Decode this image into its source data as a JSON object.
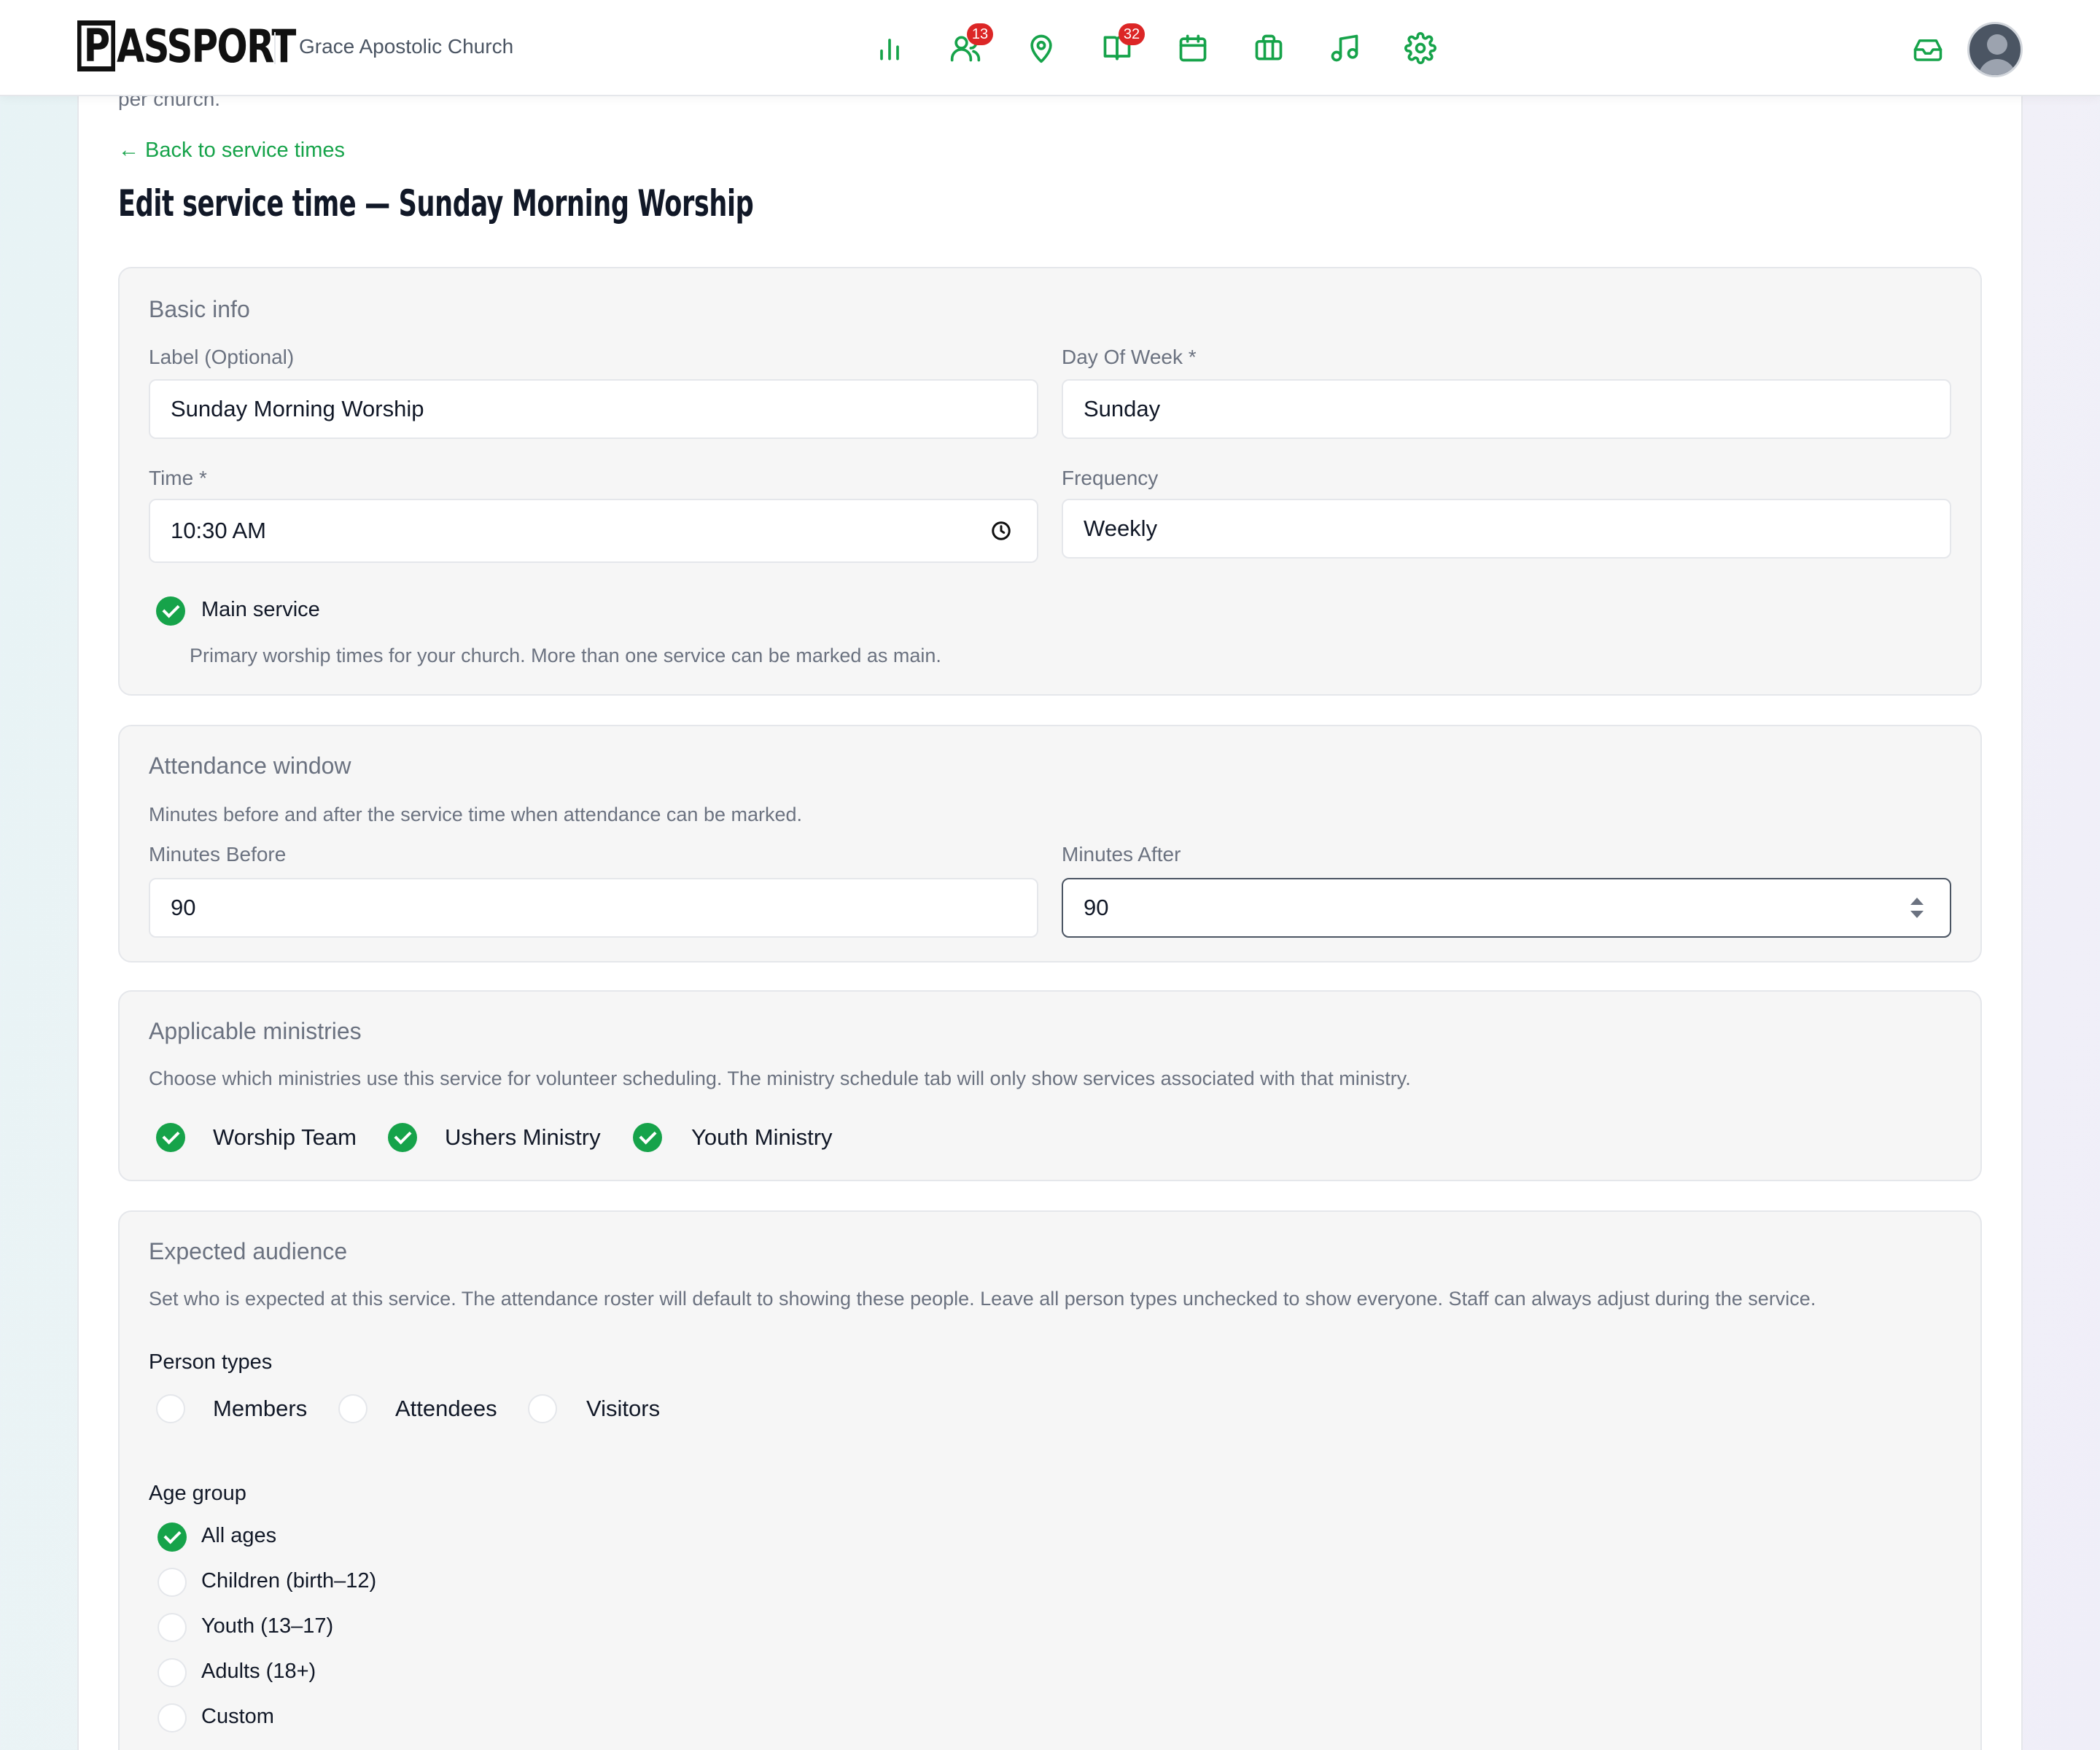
{
  "header": {
    "logo_text_p": "P",
    "logo_text_rest": "ASSPORT",
    "church_name": "Grace Apostolic Church",
    "nav": [
      {
        "icon": "bar-chart-icon",
        "badge": ""
      },
      {
        "icon": "people-icon",
        "badge": "13"
      },
      {
        "icon": "map-pin-icon",
        "badge": ""
      },
      {
        "icon": "book-open-icon",
        "badge": "32"
      },
      {
        "icon": "calendar-icon",
        "badge": ""
      },
      {
        "icon": "briefcase-icon",
        "badge": ""
      },
      {
        "icon": "music-icon",
        "badge": ""
      },
      {
        "icon": "gear-icon",
        "badge": ""
      }
    ],
    "accent_color": "#16a34a",
    "badge_color": "#dc2626"
  },
  "page": {
    "cut_text": "per church.",
    "back_link": "← Back to service times",
    "title": "Edit service time — Sunday Morning Worship"
  },
  "basic_info": {
    "title": "Basic info",
    "label_field": {
      "label": "Label (Optional)",
      "value": "Sunday Morning Worship"
    },
    "day_field": {
      "label": "Day Of Week *",
      "value": "Sunday"
    },
    "time_field": {
      "label": "Time *",
      "value": "10:30 AM"
    },
    "frequency_field": {
      "label": "Frequency",
      "value": "Weekly"
    },
    "main_service": {
      "label": "Main service",
      "checked": true,
      "help": "Primary worship times for your church. More than one service can be marked as main."
    }
  },
  "attendance": {
    "title": "Attendance window",
    "desc": "Minutes before and after the service time when attendance can be marked.",
    "before": {
      "label": "Minutes Before",
      "value": "90"
    },
    "after": {
      "label": "Minutes After",
      "value": "90"
    }
  },
  "ministries": {
    "title": "Applicable ministries",
    "desc": "Choose which ministries use this service for volunteer scheduling. The ministry schedule tab will only show services associated with that ministry.",
    "items": [
      {
        "label": "Worship Team",
        "checked": true
      },
      {
        "label": "Ushers Ministry",
        "checked": true
      },
      {
        "label": "Youth Ministry",
        "checked": true
      }
    ]
  },
  "audience": {
    "title": "Expected audience",
    "desc": "Set who is expected at this service. The attendance roster will default to showing these people. Leave all person types unchecked to show everyone. Staff can always adjust during the service.",
    "person_types_label": "Person types",
    "person_types": [
      {
        "label": "Members",
        "checked": false
      },
      {
        "label": "Attendees",
        "checked": false
      },
      {
        "label": "Visitors",
        "checked": false
      }
    ],
    "age_group_label": "Age group",
    "age_groups": [
      {
        "label": "All ages",
        "checked": true
      },
      {
        "label": "Children (birth–12)",
        "checked": false
      },
      {
        "label": "Youth (13–17)",
        "checked": false
      },
      {
        "label": "Adults (18+)",
        "checked": false
      },
      {
        "label": "Custom",
        "checked": false
      }
    ]
  }
}
